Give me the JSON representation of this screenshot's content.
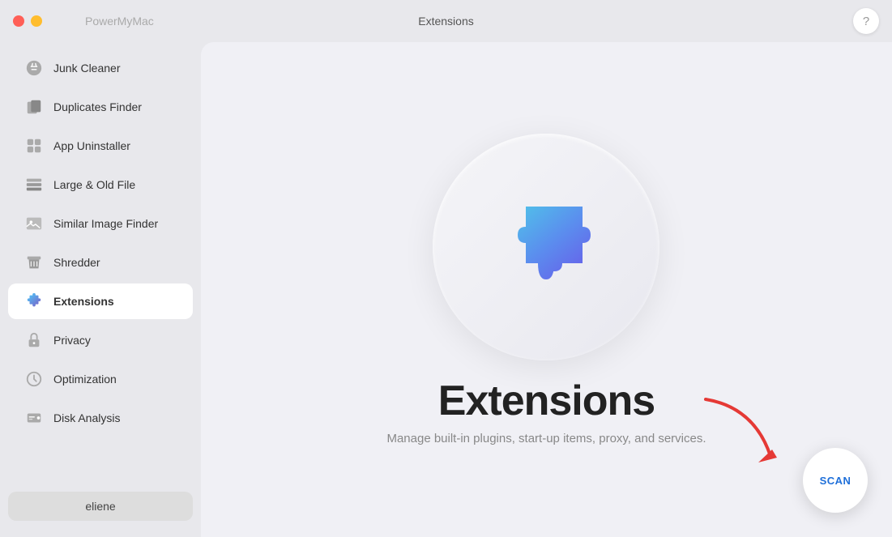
{
  "app": {
    "name": "PowerMyMac",
    "header_title": "Extensions",
    "help_label": "?"
  },
  "sidebar": {
    "items": [
      {
        "id": "junk-cleaner",
        "label": "Junk Cleaner",
        "active": false
      },
      {
        "id": "duplicates-finder",
        "label": "Duplicates Finder",
        "active": false
      },
      {
        "id": "app-uninstaller",
        "label": "App Uninstaller",
        "active": false
      },
      {
        "id": "large-old-file",
        "label": "Large & Old File",
        "active": false
      },
      {
        "id": "similar-image-finder",
        "label": "Similar Image Finder",
        "active": false
      },
      {
        "id": "shredder",
        "label": "Shredder",
        "active": false
      },
      {
        "id": "extensions",
        "label": "Extensions",
        "active": true
      },
      {
        "id": "privacy",
        "label": "Privacy",
        "active": false
      },
      {
        "id": "optimization",
        "label": "Optimization",
        "active": false
      },
      {
        "id": "disk-analysis",
        "label": "Disk Analysis",
        "active": false
      }
    ],
    "user": "eliene"
  },
  "content": {
    "title": "Extensions",
    "subtitle": "Manage built-in plugins, start-up items, proxy, and services.",
    "scan_label": "SCAN"
  }
}
